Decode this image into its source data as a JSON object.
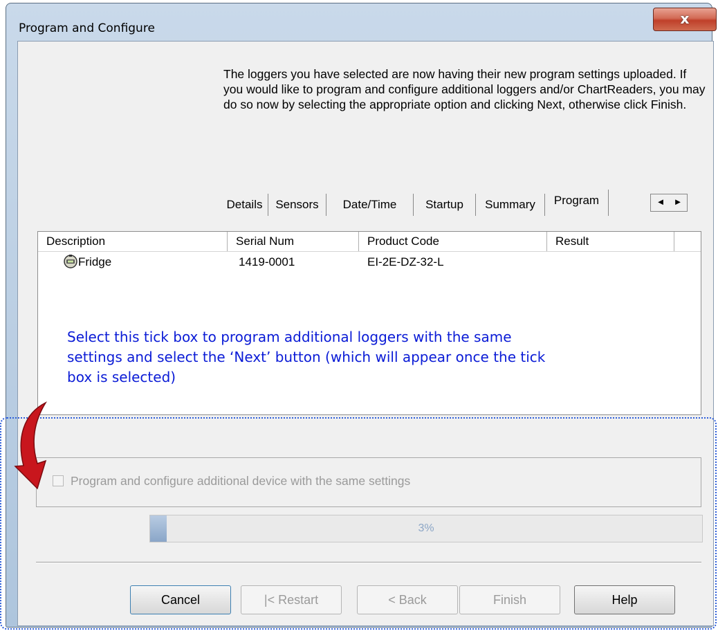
{
  "window": {
    "title": "Program and Configure",
    "close_glyph": "x"
  },
  "intro_text": "The loggers you have selected are now having their new program settings uploaded. If you would like to program and configure additional loggers and/or ChartReaders, you may do so now by selecting the appropriate option and clicking Next, otherwise click Finish.",
  "tabs": [
    {
      "label": "Details"
    },
    {
      "label": "Sensors"
    },
    {
      "label": "Date/Time"
    },
    {
      "label": "Startup"
    },
    {
      "label": "Summary"
    },
    {
      "label": "Program",
      "active": true
    }
  ],
  "tab_scroll": {
    "left": "◄",
    "right": "►"
  },
  "table": {
    "columns": [
      "Description",
      "Serial Num",
      "Product Code",
      "Result"
    ],
    "rows": [
      {
        "description": "Fridge",
        "serial": "1419-0001",
        "product_code": "EI-2E-DZ-32-L",
        "result": "",
        "icon": "logger-device-icon"
      }
    ]
  },
  "annotation": {
    "text": "Select this tick box to program additional loggers with the same settings and select the ‘Next’ button (which will appear once the tick box is selected)",
    "color": "#0a1bd6"
  },
  "checkbox": {
    "label": "Program and configure additional device with the same settings",
    "checked": false,
    "enabled": false
  },
  "progress": {
    "percent_text": "3%",
    "value": 0.03
  },
  "buttons": {
    "cancel": "Cancel",
    "restart": "|< Restart",
    "back": "< Back",
    "finish": "Finish",
    "help": "Help"
  }
}
